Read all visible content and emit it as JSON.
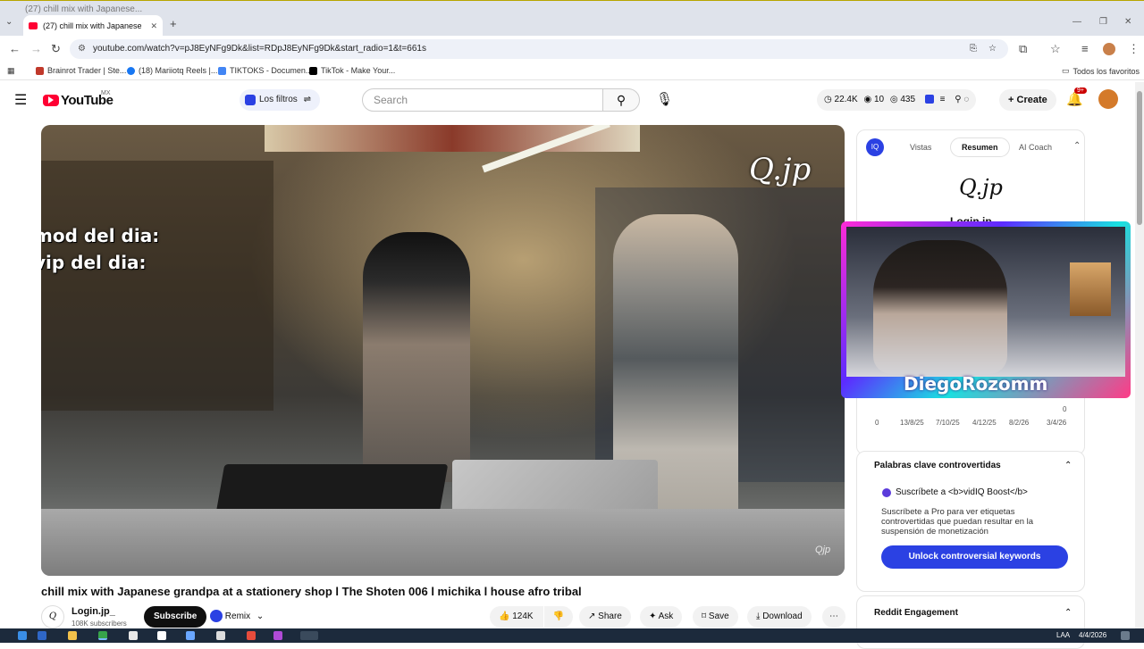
{
  "browser": {
    "ghost_tab": "(27) chill mix with Japanese...",
    "active_tab": "(27) chill mix with Japanese",
    "url": "youtube.com/watch?v=pJ8EyNFg9Dk&list=RDpJ8EyNFg9Dk&start_radio=1&t=661s",
    "bookmarks": [
      "Brainrot Trader | Ste...",
      "(18) Mariiotq Reels |...",
      "TIKTOKS - Documen...",
      "TikTok - Make Your..."
    ],
    "all_bookmarks": "Todos los favoritos"
  },
  "yt": {
    "logo": "YouTube",
    "region": "MX",
    "filters": "Los filtros",
    "search_placeholder": "Search",
    "stat_views": "22.4K",
    "stat_a": "10",
    "stat_b": "435",
    "create": "Create",
    "notif_badge": "9+"
  },
  "video": {
    "overlay_line1": "mod del dia:",
    "overlay_line2": "vip del dia:",
    "watermark": "Q.jp",
    "corner_mark": "Qjp",
    "streamer": "DiegoRozomm",
    "title": "chill mix with Japanese grandpa at a stationery shop l The Shoten 006 l michika l house afro tribal"
  },
  "channel": {
    "name": "Login.jp_",
    "subs": "108K subscribers",
    "subscribe": "Subscribe",
    "remix": "Remix"
  },
  "actions": {
    "likes": "124K",
    "share": "Share",
    "ask": "Ask",
    "save": "Save",
    "download": "Download"
  },
  "panel": {
    "tabs": [
      "Vistas",
      "Resumen",
      "AI Coach"
    ],
    "logo": "Q.jp",
    "channel_partial": "Login.jp_",
    "axis_zero": "0",
    "axis_top": "0",
    "dates": [
      "13/8/25",
      "7/10/25",
      "4/12/25",
      "8/2/26",
      "3/4/26"
    ],
    "controversial_title": "Palabras clave controvertidas",
    "subscribe_line": "Suscríbete a <b>vidIQ Boost</b>",
    "subscribe_desc": "Suscríbete a Pro para ver etiquetas controvertidas que puedan resultar en la suspensión de monetización",
    "unlock": "Unlock controversial keywords",
    "reddit": "Reddit Engagement"
  },
  "taskbar": {
    "lang": "LAA",
    "date": "4/4/2026"
  },
  "colors": {
    "youtube_red": "#ff0033",
    "vidiq_blue": "#2b41e3"
  }
}
